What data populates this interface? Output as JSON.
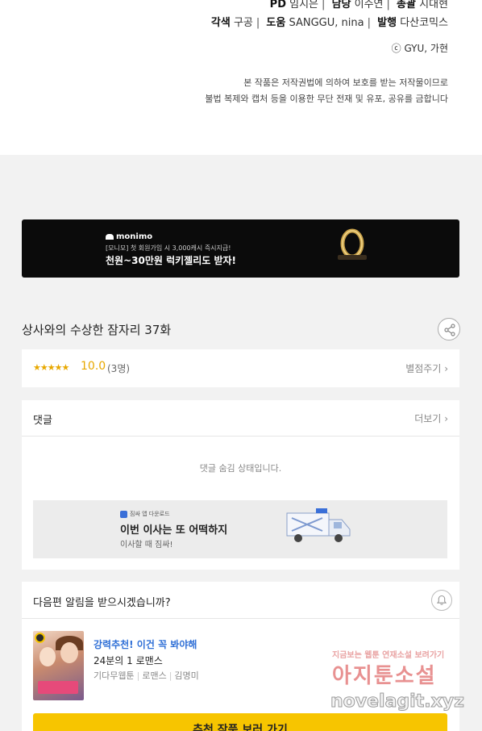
{
  "credits": {
    "line1": {
      "pd_label": "PD",
      "pd_value": "임지은",
      "lead_label": "담당",
      "lead_value": "이주연",
      "total_label": "총괄",
      "total_value": "지대현"
    },
    "line2": {
      "adapt_label": "각색",
      "adapt_value": "구공",
      "assist_label": "도움",
      "assist_value": "SANGGU, nina",
      "publisher_label": "발행",
      "publisher_value": "다산코믹스"
    },
    "copyright": "ⓒ GYU, 가현",
    "notice1": "본 작품은 저작권법에 의하여 보호를 받는 저작물이므로",
    "notice2": "불법 복제와 캡처 등을 이용한 무단 전재 및 유포, 공유를 금합니다"
  },
  "banner": {
    "brand": "monimo",
    "sub": "[모니모] 첫 회원가입 시 3,000캐시 즉시지급!",
    "headline": "천원~30만원 럭키젤리도 받자!"
  },
  "episode": {
    "title": "상사와의 수상한 잠자리 37화"
  },
  "rating": {
    "stars": "★★★★★",
    "score": "10.0",
    "count": "(3명)",
    "rate_link": "별점주기 ›"
  },
  "comments": {
    "label": "댓글",
    "more": "더보기 ›",
    "hidden_message": "댓글 숨김 상태입니다.",
    "ad": {
      "brand": "짐싸 앱 다운로드",
      "title": "이번 이사는 또 어떡하지",
      "subtitle": "이사할 때 짐싸!"
    }
  },
  "notify": {
    "question": "다음편 알림을 받으시겠습니까?",
    "rec_tag": "강력추천! 이건 꼭 봐야해",
    "rec_title": "24분의 1 로맨스",
    "rec_meta1": "기다무웹툰",
    "rec_meta2": "로맨스",
    "rec_meta3": "김명미",
    "cta": "추천 작품 보러 가기"
  },
  "watermark": {
    "line1": "지금보는 웹툰 연재소설 보려가기",
    "line2": "아지툰소설",
    "line3": "novelagit.xyz"
  },
  "colors": {
    "accent_yellow": "#f7c500",
    "star_color": "#e8a800",
    "link_blue": "#2f6fd6"
  }
}
